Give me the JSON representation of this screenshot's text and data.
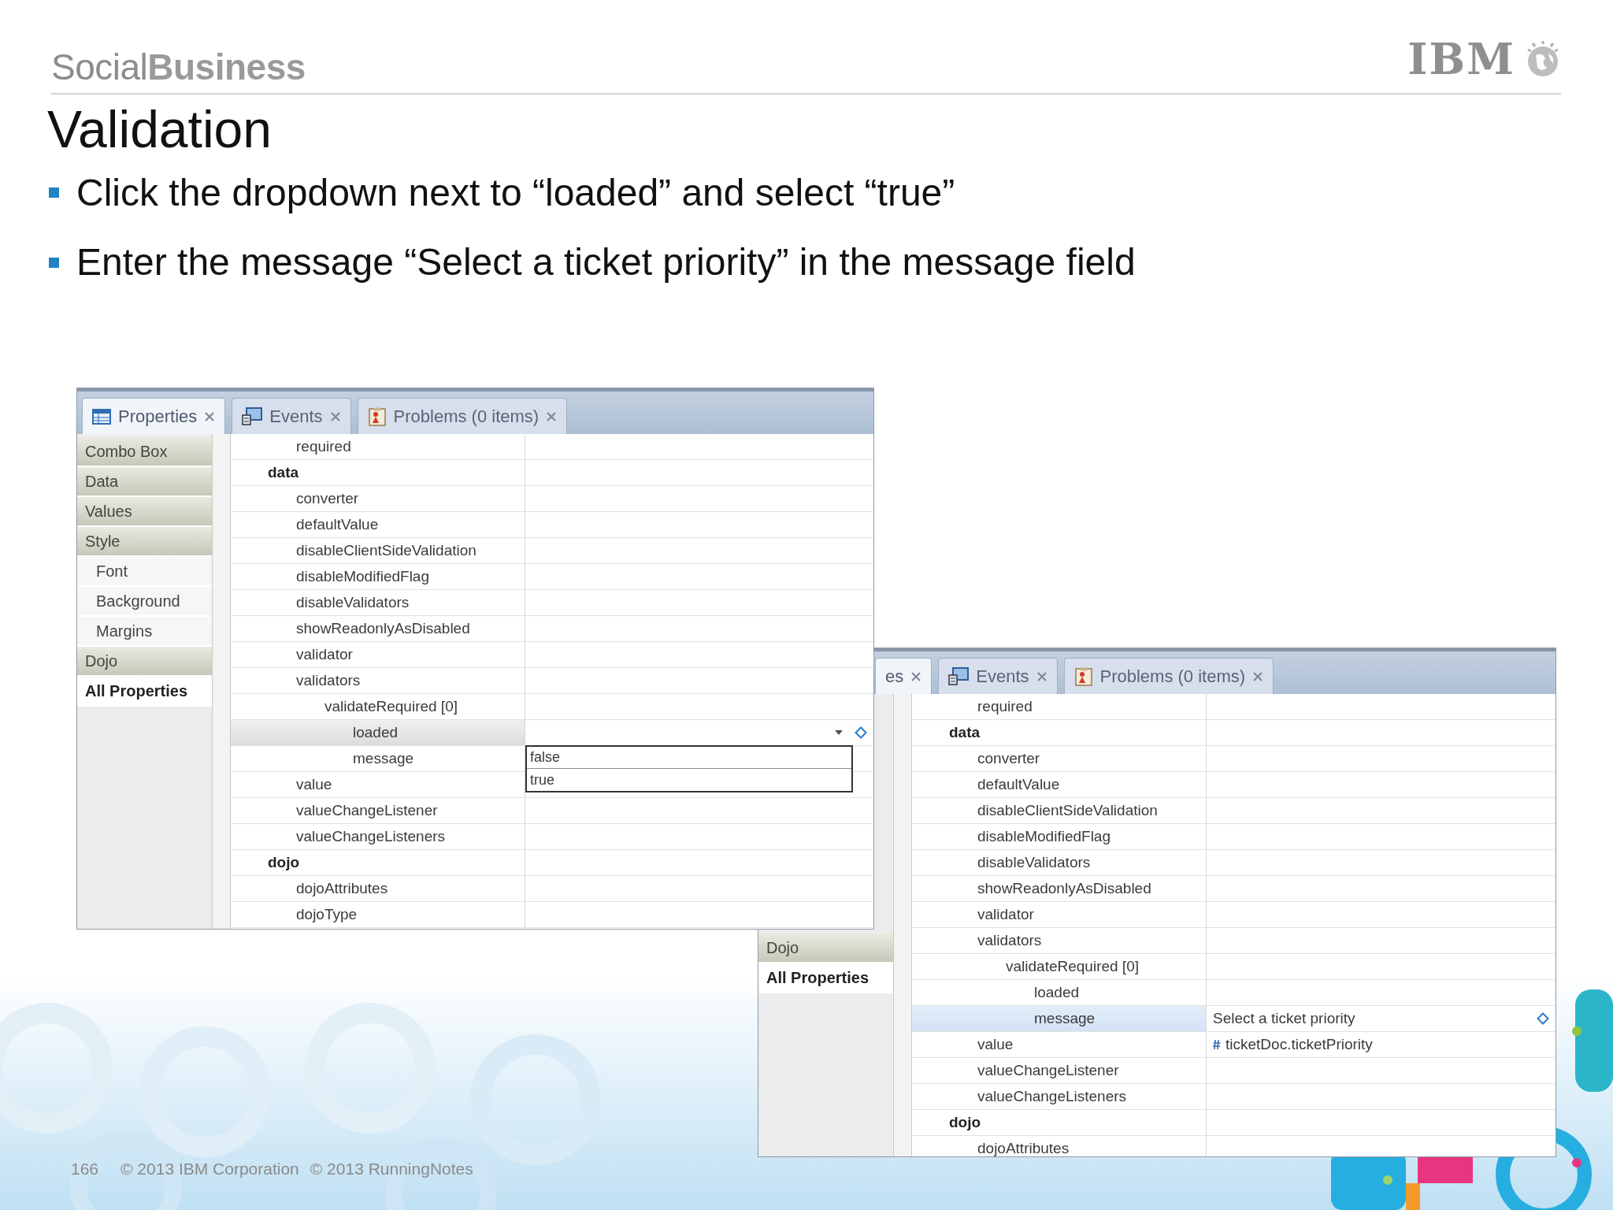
{
  "header": {
    "brand": "Social**Business**",
    "logo": "IBM"
  },
  "title": "Validation",
  "bullets": [
    "Click the dropdown next to “loaded” and select “true”",
    "Enter the message “Select a ticket priority” in the message field"
  ],
  "panels": [
    {
      "tabs": [
        {
          "label": "Properties",
          "kind": "properties",
          "selected": true
        },
        {
          "label": "Events",
          "kind": "events",
          "selected": false
        },
        {
          "label": "Problems (0 items)",
          "kind": "problems",
          "selected": false
        }
      ],
      "sidebar": [
        {
          "label": "Combo Box",
          "kind": "group",
          "selected": false
        },
        {
          "label": "Data",
          "kind": "group",
          "selected": false
        },
        {
          "label": "Values",
          "kind": "group",
          "selected": false
        },
        {
          "label": "Style",
          "kind": "group",
          "selected": false
        },
        {
          "label": "Font",
          "kind": "sub",
          "selected": false
        },
        {
          "label": "Background",
          "kind": "sub",
          "selected": false
        },
        {
          "label": "Margins",
          "kind": "sub",
          "selected": false
        },
        {
          "label": "Dojo",
          "kind": "group",
          "selected": false
        },
        {
          "label": "All Properties",
          "kind": "group",
          "selected": true
        }
      ],
      "rows": [
        {
          "name": "required",
          "kind": "property",
          "selected": false
        },
        {
          "name": "data",
          "kind": "category",
          "selected": false,
          "children": [
            {
              "name": "converter",
              "kind": "property",
              "selected": false
            },
            {
              "name": "defaultValue",
              "kind": "property",
              "selected": false
            },
            {
              "name": "disableClientSideValidation",
              "kind": "property",
              "selected": false
            },
            {
              "name": "disableModifiedFlag",
              "kind": "property",
              "selected": false
            },
            {
              "name": "disableValidators",
              "kind": "property",
              "selected": false
            },
            {
              "name": "showReadonlyAsDisabled",
              "kind": "property",
              "selected": false
            },
            {
              "name": "validator",
              "kind": "property",
              "selected": false
            },
            {
              "name": "validators",
              "kind": "property",
              "selected": false,
              "children": [
                {
                  "name": "validateRequired [0]",
                  "kind": "property",
                  "selected": false,
                  "children": [
                    {
                      "name": "loaded",
                      "kind": "property",
                      "selected": true,
                      "options": [
                        {
                          "label": "false",
                          "selected": false
                        },
                        {
                          "label": "true",
                          "selected": false
                        }
                      ]
                    },
                    {
                      "name": "message",
                      "kind": "property",
                      "selected": false
                    }
                  ]
                }
              ]
            },
            {
              "name": "value",
              "kind": "property",
              "selected": false
            },
            {
              "name": "valueChangeListener",
              "kind": "property",
              "selected": false
            },
            {
              "name": "valueChangeListeners",
              "kind": "property",
              "selected": false
            }
          ]
        },
        {
          "name": "dojo",
          "kind": "category",
          "selected": false,
          "children": [
            {
              "name": "dojoAttributes",
              "kind": "property",
              "selected": false
            },
            {
              "name": "dojoType",
              "kind": "property",
              "selected": false
            }
          ]
        }
      ]
    },
    {
      "tabs": [
        {
          "label": "es",
          "kind": "partial",
          "selected": true
        },
        {
          "label": "Events",
          "kind": "events",
          "selected": false
        },
        {
          "label": "Problems (0 items)",
          "kind": "problems",
          "selected": false
        }
      ],
      "sidebar": [
        {
          "label": "Dojo",
          "kind": "group",
          "selected": false
        },
        {
          "label": "All Properties",
          "kind": "group",
          "selected": true
        }
      ],
      "rows": [
        {
          "name": "required",
          "kind": "property",
          "selected": false
        },
        {
          "name": "data",
          "kind": "category",
          "selected": false,
          "children": [
            {
              "name": "converter",
              "kind": "property",
              "selected": false
            },
            {
              "name": "defaultValue",
              "kind": "property",
              "selected": false
            },
            {
              "name": "disableClientSideValidation",
              "kind": "property",
              "selected": false
            },
            {
              "name": "disableModifiedFlag",
              "kind": "property",
              "selected": false
            },
            {
              "name": "disableValidators",
              "kind": "property",
              "selected": false
            },
            {
              "name": "showReadonlyAsDisabled",
              "kind": "property",
              "selected": false
            },
            {
              "name": "validator",
              "kind": "property",
              "selected": false
            },
            {
              "name": "validators",
              "kind": "property",
              "selected": false,
              "children": [
                {
                  "name": "validateRequired [0]",
                  "kind": "property",
                  "selected": false,
                  "children": [
                    {
                      "name": "loaded",
                      "kind": "property",
                      "selected": false
                    },
                    {
                      "name": "message",
                      "kind": "property",
                      "selected": true,
                      "value": "Select a ticket priority"
                    }
                  ]
                }
              ]
            },
            {
              "name": "value",
              "kind": "property",
              "selected": false,
              "value": "ticketDoc.ticketPriority",
              "bound": true
            },
            {
              "name": "valueChangeListener",
              "kind": "property",
              "selected": false
            },
            {
              "name": "valueChangeListeners",
              "kind": "property",
              "selected": false
            }
          ]
        },
        {
          "name": "dojo",
          "kind": "category",
          "selected": false,
          "children": [
            {
              "name": "dojoAttributes",
              "kind": "property",
              "selected": false
            }
          ]
        }
      ]
    }
  ],
  "footer": {
    "page": "166",
    "copyrights": [
      "© 2013 IBM Corporation",
      "© 2013 RunningNotes"
    ]
  }
}
